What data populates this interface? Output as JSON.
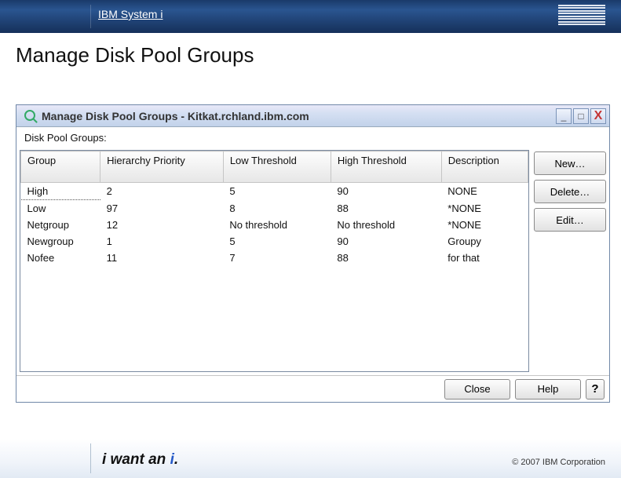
{
  "slide": {
    "brand": "IBM System i",
    "title": "Manage Disk Pool Groups",
    "tagline_prefix": "i want an ",
    "tagline_accent": "i",
    "tagline_suffix": ".",
    "copyright": "© 2007 IBM Corporation"
  },
  "window": {
    "title": "Manage Disk Pool Groups - Kitkat.rchland.ibm.com",
    "list_label": "Disk Pool Groups:",
    "columns": {
      "group": "Group",
      "hierarchy": "Hierarchy Priority",
      "low": "Low Threshold",
      "high": "High Threshold",
      "desc": "Description"
    },
    "rows": [
      {
        "group": "High",
        "hierarchy": "2",
        "low": "5",
        "high": "90",
        "desc": "NONE"
      },
      {
        "group": "Low",
        "hierarchy": "97",
        "low": "8",
        "high": "88",
        "desc": "*NONE"
      },
      {
        "group": "Netgroup",
        "hierarchy": "12",
        "low": "No threshold",
        "high": "No threshold",
        "desc": "*NONE"
      },
      {
        "group": "Newgroup",
        "hierarchy": "1",
        "low": "5",
        "high": "90",
        "desc": "Groupy"
      },
      {
        "group": "Nofee",
        "hierarchy": "11",
        "low": "7",
        "high": "88",
        "desc": "for that"
      }
    ],
    "buttons": {
      "new": "New…",
      "delete": "Delete…",
      "edit": "Edit…",
      "close": "Close",
      "help": "Help",
      "help_icon": "?"
    },
    "controls": {
      "minimize": "_",
      "maximize": "□",
      "close": "X"
    }
  }
}
